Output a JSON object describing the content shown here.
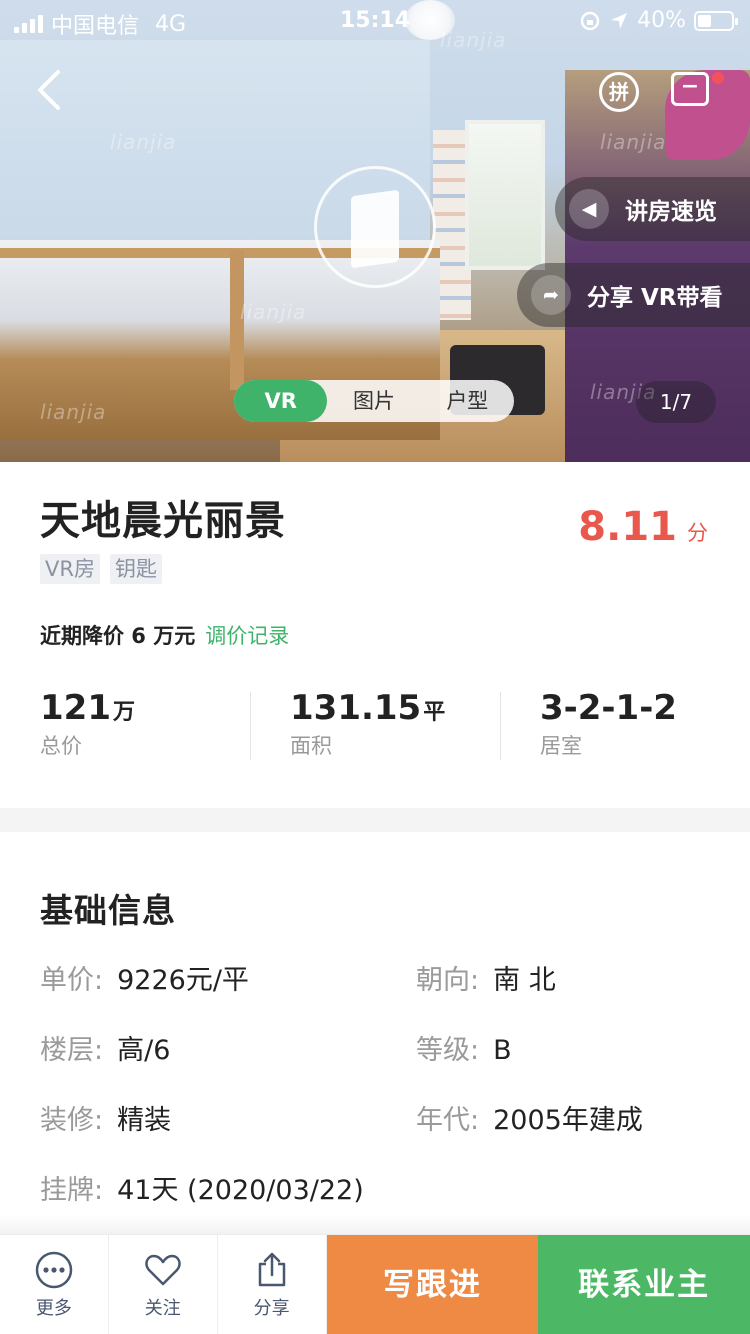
{
  "status_bar": {
    "carrier": "中国电信",
    "network": "4G",
    "time": "15:14",
    "battery": "40%"
  },
  "hero": {
    "watermark": "lianjia",
    "quick_icon_text": "拼",
    "pill_audio": "讲房速览",
    "pill_share": "分享 VR带看",
    "tabs": [
      "VR",
      "图片",
      "户型"
    ],
    "active_tab": "VR",
    "counter": "1/7"
  },
  "listing": {
    "title": "天地晨光丽景",
    "score": "8.11",
    "score_unit": "分",
    "tags": [
      "VR房",
      "钥匙"
    ],
    "price_drop": "近期降价 6 万元",
    "price_history_link": "调价记录",
    "stats": [
      {
        "value": "121",
        "unit": "万",
        "label": "总价"
      },
      {
        "value": "131.15",
        "unit": "平",
        "label": "面积"
      },
      {
        "value": "3-2-1-2",
        "unit": "",
        "label": "居室"
      }
    ]
  },
  "basic_info": {
    "title": "基础信息",
    "rows": [
      {
        "label": "单价:",
        "value": "9226元/平"
      },
      {
        "label": "朝向:",
        "value": "南 北"
      },
      {
        "label": "楼层:",
        "value": "高/6"
      },
      {
        "label": "等级:",
        "value": "B"
      },
      {
        "label": "装修:",
        "value": "精装"
      },
      {
        "label": "年代:",
        "value": "2005年建成"
      },
      {
        "label": "挂牌:",
        "value": "41天 (2020/03/22)"
      }
    ]
  },
  "bottom_bar": {
    "more": "更多",
    "follow": "关注",
    "share": "分享",
    "follow_up": "写跟进",
    "contact_owner": "联系业主"
  },
  "colors": {
    "accent_green": "#3fb36a",
    "score_red": "#e8584d",
    "button_orange": "#ef8a44",
    "button_green": "#4cb865"
  },
  "icons": [
    "signal-icon",
    "location-arrow-icon",
    "rotation-lock-icon",
    "battery-icon",
    "back-arrow-icon",
    "pin-icon",
    "message-icon",
    "vr-icon",
    "speaker-icon",
    "share-arrow-icon",
    "more-dots-icon",
    "heart-icon",
    "share-icon"
  ]
}
